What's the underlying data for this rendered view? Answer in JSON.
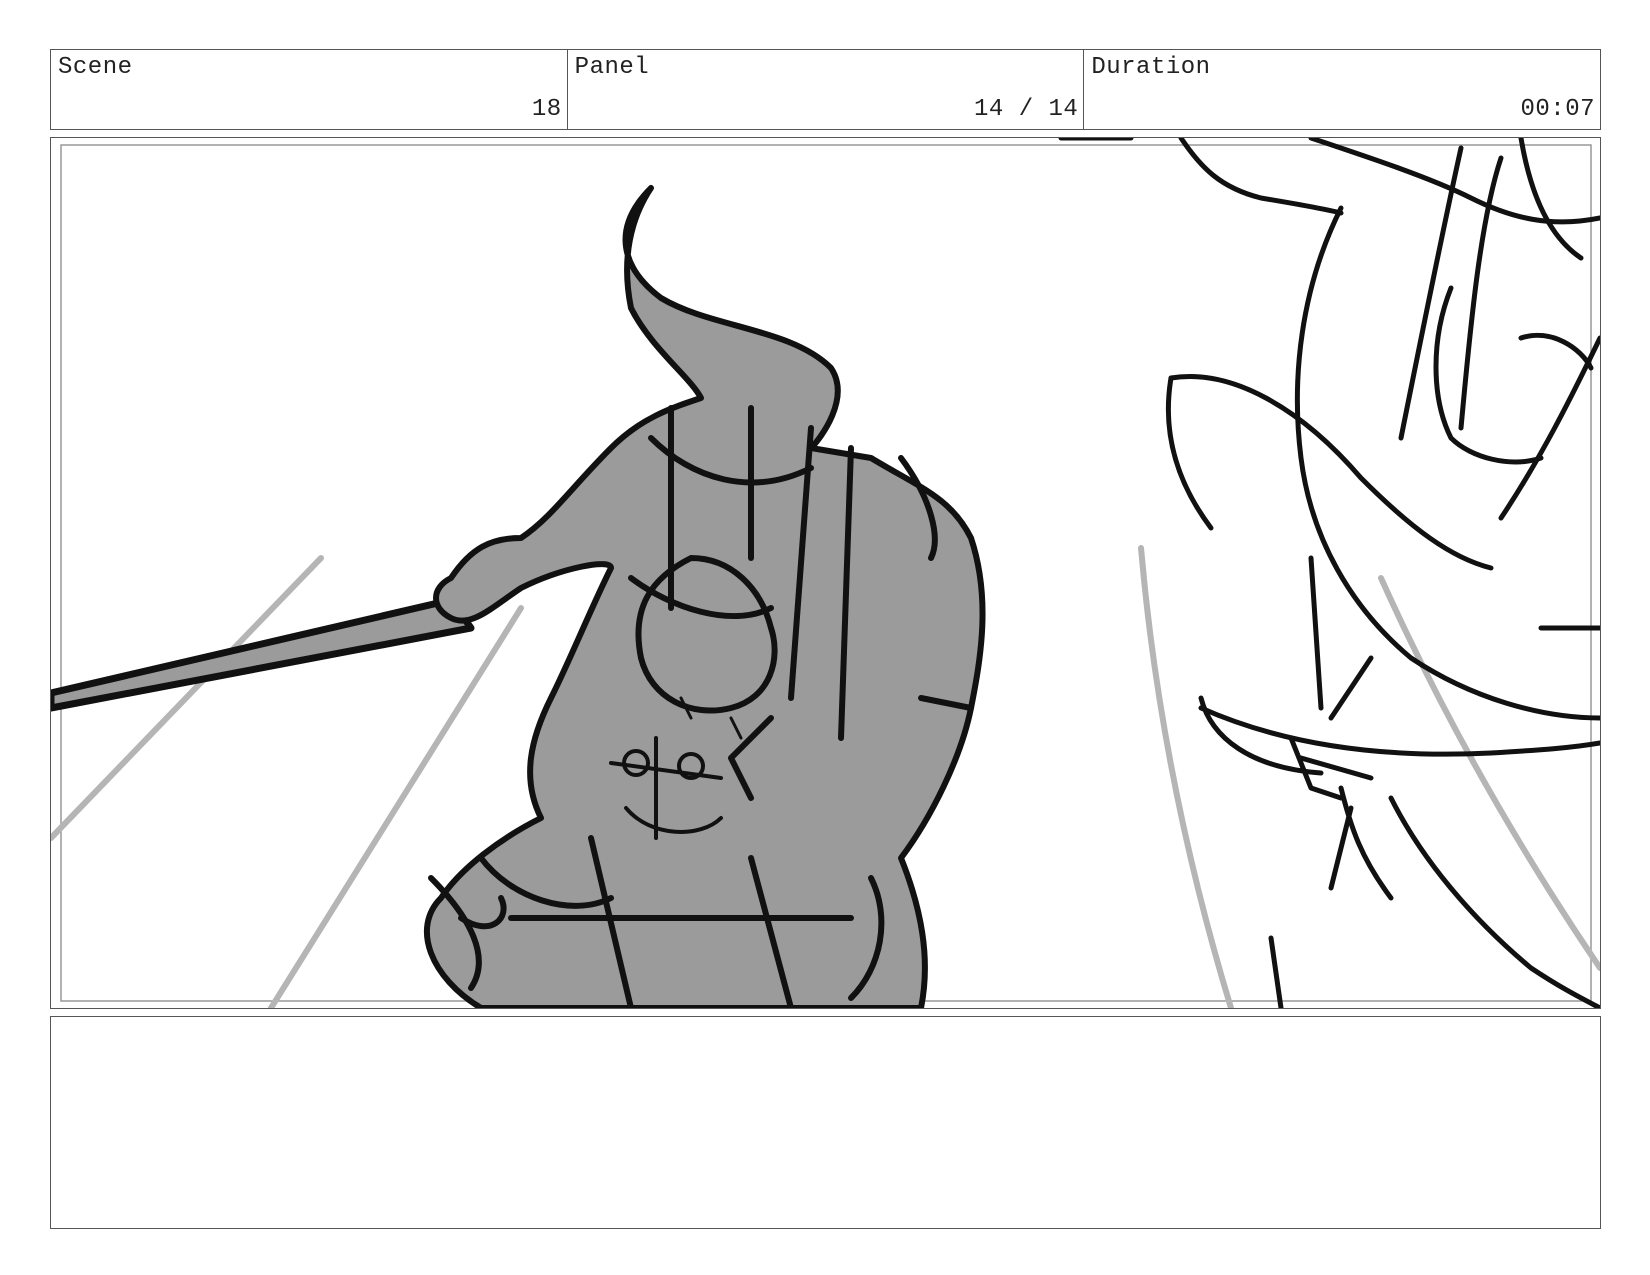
{
  "header": {
    "scene_label": "Scene",
    "scene_value": "18",
    "panel_label": "Panel",
    "panel_value": "14 / 14",
    "duration_label": "Duration",
    "duration_value": "00:07"
  },
  "notes": {
    "text": ""
  }
}
